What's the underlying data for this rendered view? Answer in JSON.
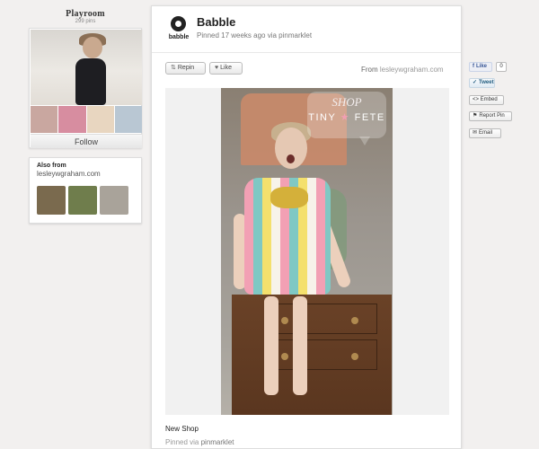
{
  "board": {
    "title": "Playroom",
    "pin_count": "299 pins",
    "follow_label": "Follow",
    "thumb_colors": [
      "#c9a7a0",
      "#d78da0",
      "#e8d6c0",
      "#b9c7d3"
    ]
  },
  "also_from": {
    "title": "Also from",
    "domain": "lesleywgraham.com",
    "thumb_colors": [
      "#7a6a4e",
      "#6f7d4c",
      "#a9a39a"
    ]
  },
  "pin": {
    "source_name": "Babble",
    "source_logo_text": "babble",
    "meta": "Pinned 17 weeks ago via pinmarklet",
    "repin_label": "Repin",
    "like_label": "Like",
    "from_prefix": "From",
    "from_domain": "lesleywgraham.com",
    "image_overlay": {
      "shop": "SHOP",
      "name_left": "TINY",
      "star": "★",
      "name_right": "FETE"
    },
    "description": "New Shop",
    "footer_prefix": "Pinned via",
    "footer_source": "pinmarklet"
  },
  "share": {
    "like": "Like",
    "like_count": "0",
    "tweet": "Tweet",
    "embed": "<> Embed",
    "report": "Report Pin",
    "email": "Email"
  },
  "colors": {
    "background": "#f2f0ef",
    "panel": "#ffffff",
    "facebook": "#3b5998"
  }
}
